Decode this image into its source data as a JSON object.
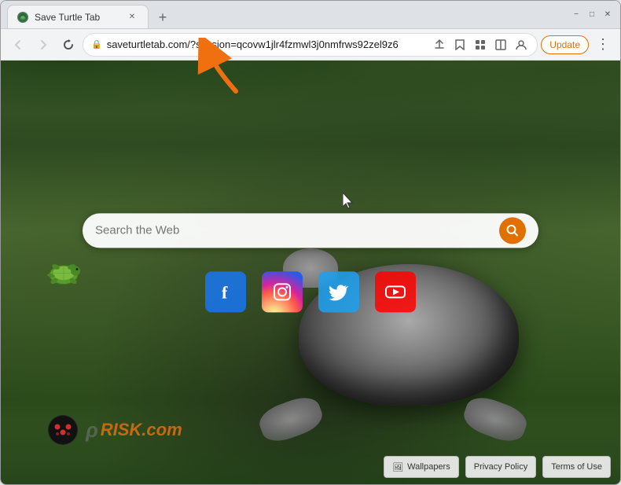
{
  "browser": {
    "tab": {
      "title": "Save Turtle Tab",
      "favicon_label": "🐢"
    },
    "new_tab_label": "+",
    "window_controls": {
      "minimize": "−",
      "maximize": "□",
      "close": "✕"
    },
    "nav": {
      "back": "←",
      "forward": "→",
      "refresh": "↻",
      "address": "saveturtletab.com/?session=qcovw1jlr4fzmwl3j0nmfrws92zel9z6",
      "share_icon": "⬆",
      "bookmark_icon": "☆",
      "extensions_icon": "🧩",
      "split_icon": "⧉",
      "profile_icon": "👤",
      "update_label": "Update",
      "menu_icon": "⋮"
    }
  },
  "page": {
    "search": {
      "placeholder": "Search the Web",
      "button_icon": "🔍"
    },
    "social_links": [
      {
        "name": "Facebook",
        "icon": "f",
        "type": "fb"
      },
      {
        "name": "Instagram",
        "icon": "📷",
        "type": "ig"
      },
      {
        "name": "Twitter",
        "icon": "🐦",
        "type": "tw"
      },
      {
        "name": "YouTube",
        "icon": "▶",
        "type": "yt"
      }
    ],
    "bottom_buttons": [
      {
        "label": "Wallpapers",
        "icon": "🖼"
      },
      {
        "label": "Privacy Policy"
      },
      {
        "label": "Terms of Use"
      }
    ],
    "watermark": {
      "prefix": "",
      "brand": "RISK.com"
    }
  },
  "annotation": {
    "arrow_color": "#f07010"
  }
}
